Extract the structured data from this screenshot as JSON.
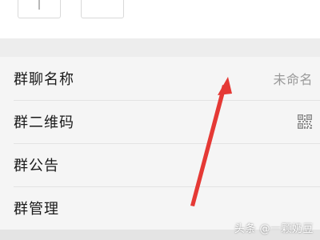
{
  "settings": {
    "rows": [
      {
        "label": "群聊名称",
        "value": "未命名"
      },
      {
        "label": "群二维码",
        "value_icon": "qr-code-icon"
      },
      {
        "label": "群公告"
      },
      {
        "label": "群管理"
      }
    ]
  },
  "watermark": {
    "text": "头条 @一颗奶豆"
  },
  "annotation": {
    "arrow_color": "#e53935"
  }
}
